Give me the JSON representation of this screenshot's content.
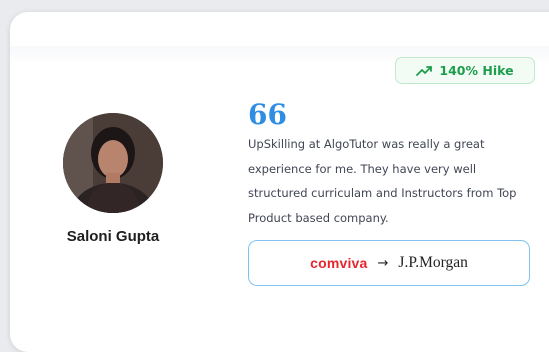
{
  "badge": {
    "label": "140% Hike",
    "icon": "trending-up-icon",
    "color": "#1e9e4d"
  },
  "person": {
    "name": "Saloni Gupta"
  },
  "testimonial": {
    "quote_mark": "66",
    "text": "UpSkilling at AlgoTutor was really a great experience for me. They have very well structured curriculam and Instructors from Top Product based company."
  },
  "transition": {
    "from": "comviva",
    "arrow": "→",
    "to": "J.P.Morgan",
    "from_color": "#e8262f"
  }
}
